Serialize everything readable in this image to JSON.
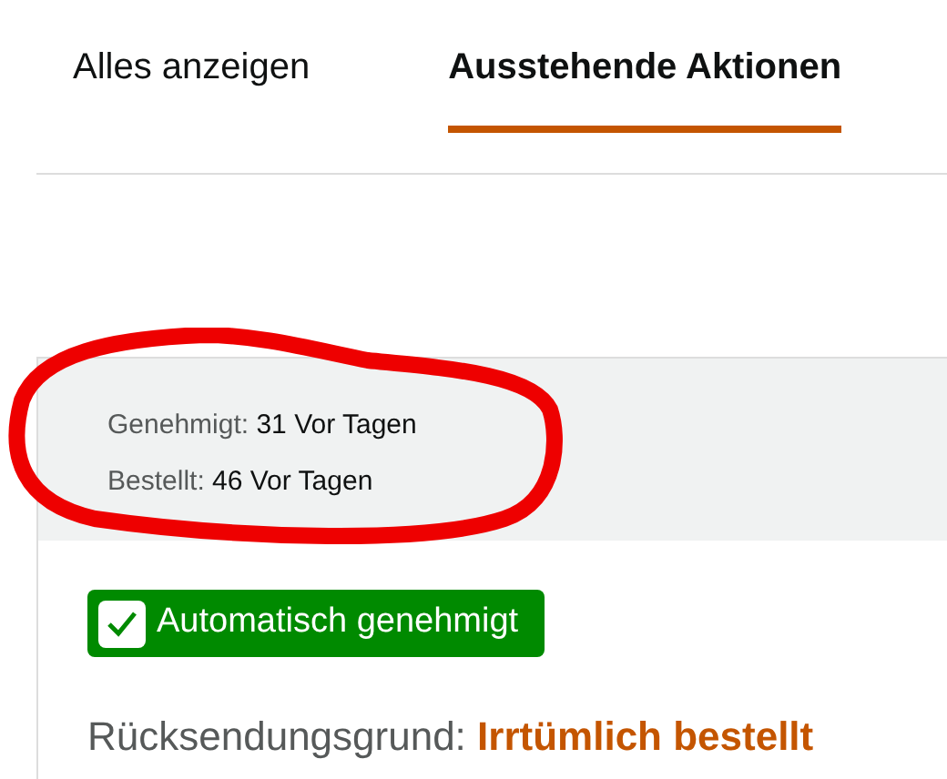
{
  "tabs": [
    {
      "label": "Alles anzeigen",
      "selected": false
    },
    {
      "label": "Ausstehende Aktionen",
      "selected": true
    }
  ],
  "return": {
    "dates": [
      {
        "label": "Genehmigt:",
        "value": "31 Vor Tagen"
      },
      {
        "label": "Bestellt:",
        "value": "46 Vor Tagen"
      }
    ],
    "badge": {
      "label": "Automatisch genehmigt",
      "checked": true
    },
    "reason": {
      "label": "Rücksendungsgrund:",
      "value": "Irrtümlich bestellt"
    }
  }
}
